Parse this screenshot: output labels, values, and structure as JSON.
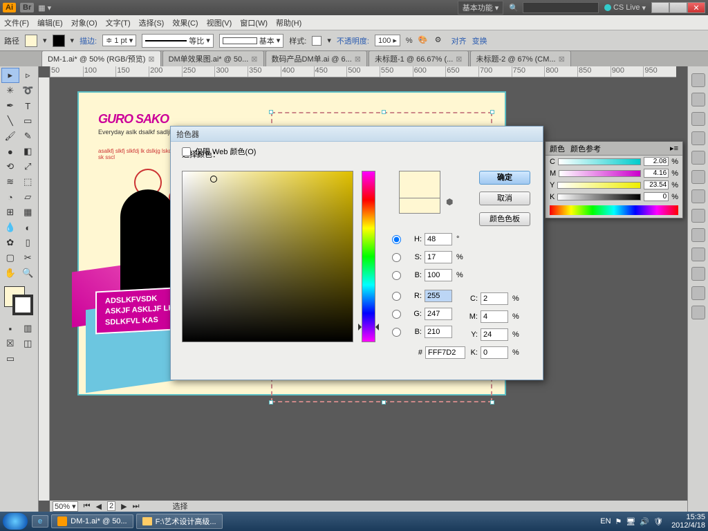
{
  "titlebar": {
    "ai": "Ai",
    "br": "Br",
    "workspace": "基本功能",
    "cslive": "CS Live"
  },
  "menu": [
    "文件(F)",
    "编辑(E)",
    "对象(O)",
    "文字(T)",
    "选择(S)",
    "效果(C)",
    "视图(V)",
    "窗口(W)",
    "帮助(H)"
  ],
  "ctrl": {
    "path": "路径",
    "stroke": "描边:",
    "stroke_pt": "1 pt",
    "ratio": "等比",
    "basic": "基本",
    "style": "样式:",
    "opacity_label": "不透明度:",
    "opacity": "100",
    "pct": "%",
    "align": "对齐",
    "transform": "变换"
  },
  "tabs": [
    {
      "label": "DM-1.ai* @ 50% (RGB/预览)",
      "active": true
    },
    {
      "label": "DM单效果图.ai* @ 50...",
      "active": false
    },
    {
      "label": "数码产品DM单.ai @ 6...",
      "active": false
    },
    {
      "label": "未标题-1 @ 66.67% (...",
      "active": false
    },
    {
      "label": "未标题-2 @ 67% (CM...",
      "active": false
    }
  ],
  "ruler_h": [
    "50",
    "100",
    "150",
    "200",
    "250",
    "300",
    "350",
    "400",
    "450",
    "500",
    "550",
    "600",
    "650",
    "700",
    "750",
    "800",
    "850",
    "900",
    "950"
  ],
  "doc": {
    "logo": "GURO SAKO",
    "sub": "Everyday aslk dsalkf sadljkfh",
    "red": "asalkfj slkfj slkfdj lk dslkjg lskdj asklf lkasjfkl sk sscl",
    "badge_l1": "ADSLKFVSDK",
    "badge_l2": "ASKJF ASKLJF LKA",
    "badge_l3": "SDLKFVL KAS"
  },
  "canvas_status": {
    "zoom": "50%",
    "page": "2",
    "select": "选择"
  },
  "cmyk": {
    "tab1": "颜色",
    "tab2": "颜色参考",
    "c": {
      "label": "C",
      "val": "2.08",
      "unit": "%"
    },
    "m": {
      "label": "M",
      "val": "4.16",
      "unit": "%"
    },
    "y": {
      "label": "Y",
      "val": "23.54",
      "unit": "%"
    },
    "k": {
      "label": "K",
      "val": "0",
      "unit": "%"
    }
  },
  "picker": {
    "title": "拾色器",
    "select_color": "选择颜色：",
    "ok": "确定",
    "cancel": "取消",
    "swatches": "颜色色板",
    "H": {
      "label": "H:",
      "val": "48",
      "unit": "°"
    },
    "S": {
      "label": "S:",
      "val": "17",
      "unit": "%"
    },
    "B": {
      "label": "B:",
      "val": "100",
      "unit": "%"
    },
    "R": {
      "label": "R:",
      "val": "255"
    },
    "G": {
      "label": "G:",
      "val": "247"
    },
    "B2": {
      "label": "B:",
      "val": "210"
    },
    "C": {
      "label": "C:",
      "val": "2",
      "unit": "%"
    },
    "M": {
      "label": "M:",
      "val": "4",
      "unit": "%"
    },
    "Y": {
      "label": "Y:",
      "val": "24",
      "unit": "%"
    },
    "K": {
      "label": "K:",
      "val": "0",
      "unit": "%"
    },
    "hex": {
      "label": "#",
      "val": "FFF7D2"
    },
    "web_only": "仅限 Web 颜色(O)"
  },
  "taskbar": {
    "task1": "DM-1.ai* @ 50...",
    "task2": "F:\\艺术设计高级...",
    "ime": "EN",
    "time": "15:35",
    "date": "2012/4/18"
  }
}
